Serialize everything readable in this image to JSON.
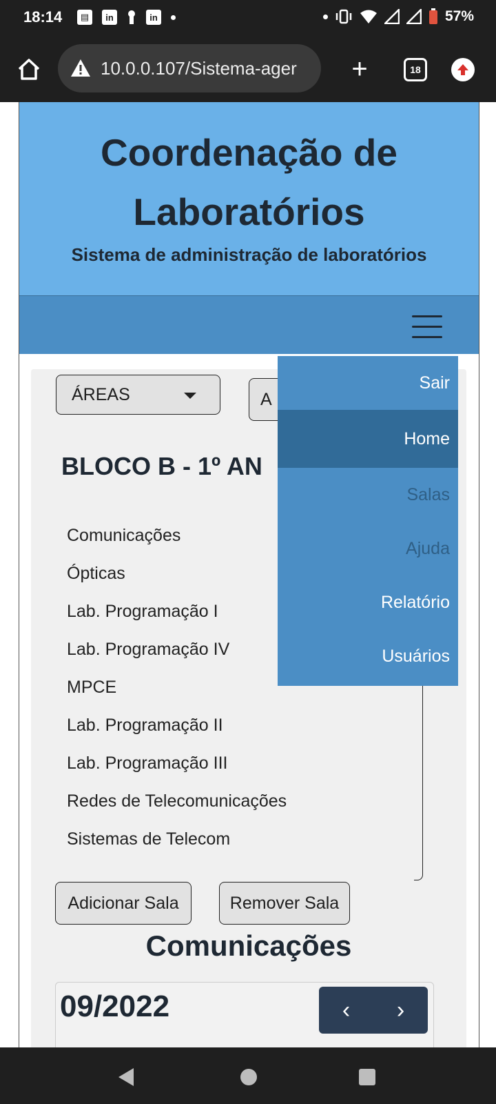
{
  "status_bar": {
    "time": "18:14",
    "notification_icons": [
      "news-icon",
      "linkedin-icon",
      "keyhole-icon",
      "linkedin-icon"
    ],
    "battery": "57%"
  },
  "browser": {
    "url": "10.0.0.107/Sistema-ager",
    "tab_count": "18"
  },
  "header": {
    "title": "Coordenação de Laboratórios",
    "subtitle": "Sistema de administração de laboratórios"
  },
  "toolbar": {
    "areas_label": "ÁREAS",
    "second_label": "A"
  },
  "block_title": "BLOCO B - 1º AN",
  "rooms": [
    "Comunicações",
    "Ópticas",
    "Lab. Programação I",
    "Lab. Programação IV",
    "MPCE",
    "Lab. Programação II",
    "Lab. Programação III",
    "Redes de Telecomunicações",
    "Sistemas de Telecom"
  ],
  "actions": {
    "add_room": "Adicionar Sala",
    "remove_room": "Remover Sala"
  },
  "selected_room": "Comunicações",
  "calendar": {
    "month": "09/2022",
    "prev": "‹",
    "next": "›"
  },
  "menu": {
    "items": [
      {
        "label": "Sair",
        "state": "normal"
      },
      {
        "label": "Home",
        "state": "active"
      },
      {
        "label": "Salas",
        "state": "muted"
      },
      {
        "label": "Ajuda",
        "state": "muted"
      },
      {
        "label": "Relatório",
        "state": "normal"
      },
      {
        "label": "Usuários",
        "state": "normal"
      }
    ]
  },
  "colors": {
    "header_bg": "#6ab1e8",
    "navbar_bg": "#4b8ec5",
    "menu_active_bg": "#316b98",
    "calendar_nav_bg": "#2c3e56"
  }
}
